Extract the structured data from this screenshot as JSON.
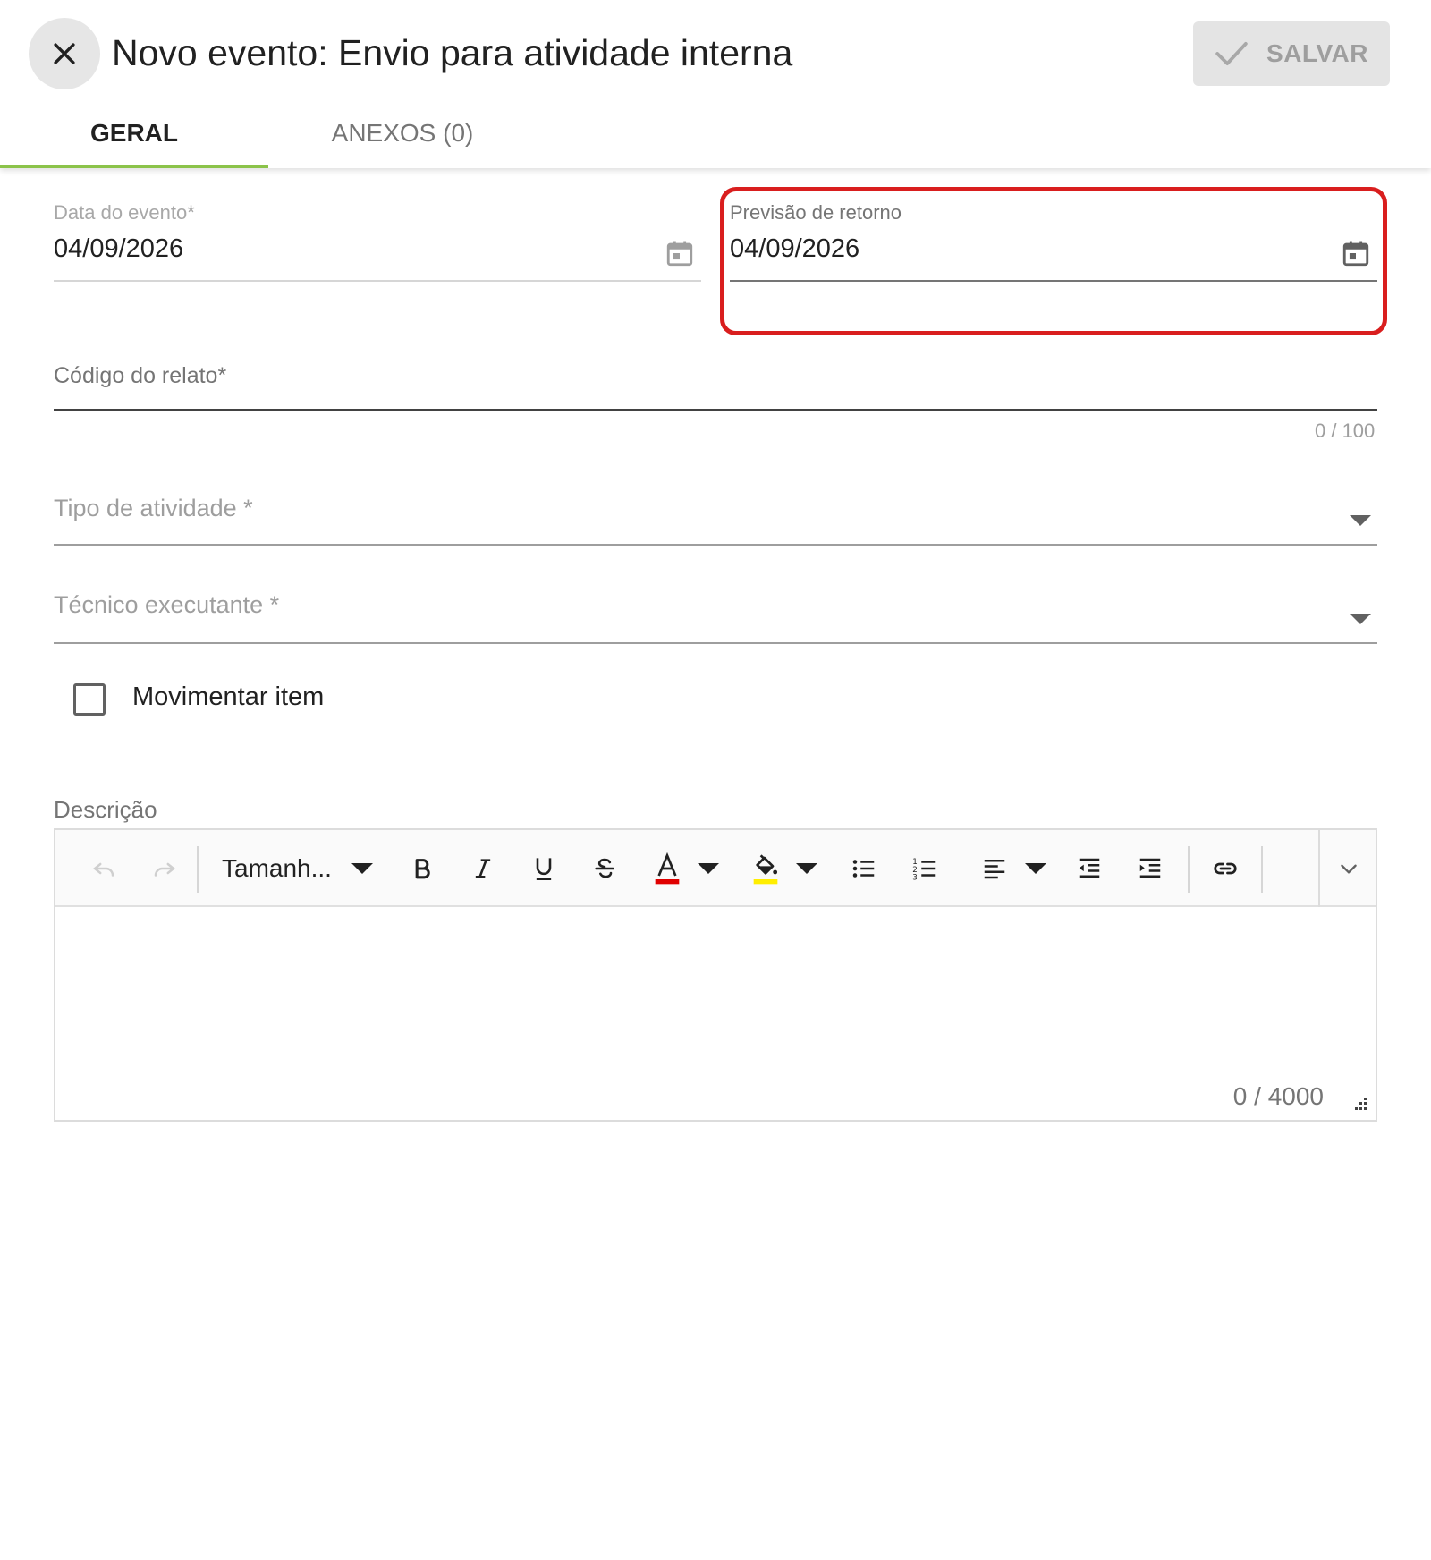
{
  "header": {
    "title": "Novo evento: Envio para atividade interna",
    "save_label": "SALVAR",
    "close_icon": "close-icon"
  },
  "tabs": [
    {
      "label": "GERAL",
      "active": true
    },
    {
      "label": "ANEXOS (0)",
      "active": false
    }
  ],
  "form": {
    "event_date": {
      "label": "Data do evento*",
      "value": "04/09/2026"
    },
    "return_forecast": {
      "label": "Previsão de retorno",
      "value": "04/09/2026"
    },
    "report_code": {
      "label": "Código do relato*",
      "value": "",
      "counter": "0 / 100"
    },
    "activity_type": {
      "label": "Tipo de atividade *"
    },
    "technician": {
      "label": "Técnico executante *"
    },
    "move_item": {
      "label": "Movimentar item",
      "checked": false
    },
    "description": {
      "label": "Descrição",
      "font_size_placeholder": "Tamanh...",
      "counter": "0 / 4000"
    }
  },
  "colors": {
    "accent": "#8bc34a",
    "highlight": "#d91e1e",
    "text_color_swatch": "#e00000",
    "highlight_color_swatch": "#ffee00"
  }
}
